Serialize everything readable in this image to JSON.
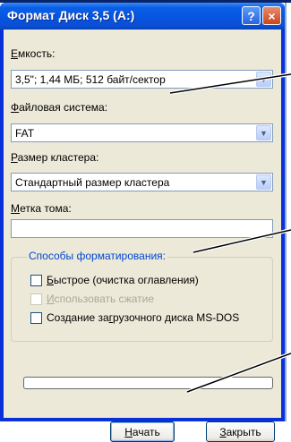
{
  "window": {
    "title": "Формат Диск 3,5 (A:)",
    "help_glyph": "?",
    "close_glyph": "×"
  },
  "capacity": {
    "label_u": "Е",
    "label_rest": "мкость:",
    "value": "3,5\"; 1,44 МБ; 512 байт/сектор"
  },
  "filesystem": {
    "label_u": "Ф",
    "label_rest": "айловая система:",
    "value": "FAT"
  },
  "cluster": {
    "label_u": "Р",
    "label_rest": "азмер кластера:",
    "value": "Стандартный размер кластера"
  },
  "volume": {
    "label_u": "М",
    "label_rest": "етка тома:",
    "value": ""
  },
  "format_options": {
    "title": "Способы форматирования:",
    "quick": {
      "u": "Б",
      "rest": "ыстрое (очистка оглавления)"
    },
    "compress": {
      "u": "И",
      "rest": "спользовать сжатие"
    },
    "msdos": {
      "pre": "Создание за",
      "u": "г",
      "rest": "рузочного диска MS-DOS"
    }
  },
  "progress": {
    "fraction": 0
  },
  "buttons": {
    "start": {
      "u": "Н",
      "rest": "ачать"
    },
    "close": {
      "u": "З",
      "rest": "акрыть"
    }
  },
  "colors": {
    "title_bar": "#0a5fe6",
    "dialog_bg": "#ece9d8",
    "group_title": "#0046d5"
  },
  "icons": {
    "dropdown": "chevron-down-icon",
    "help": "help-icon",
    "close": "close-icon"
  }
}
